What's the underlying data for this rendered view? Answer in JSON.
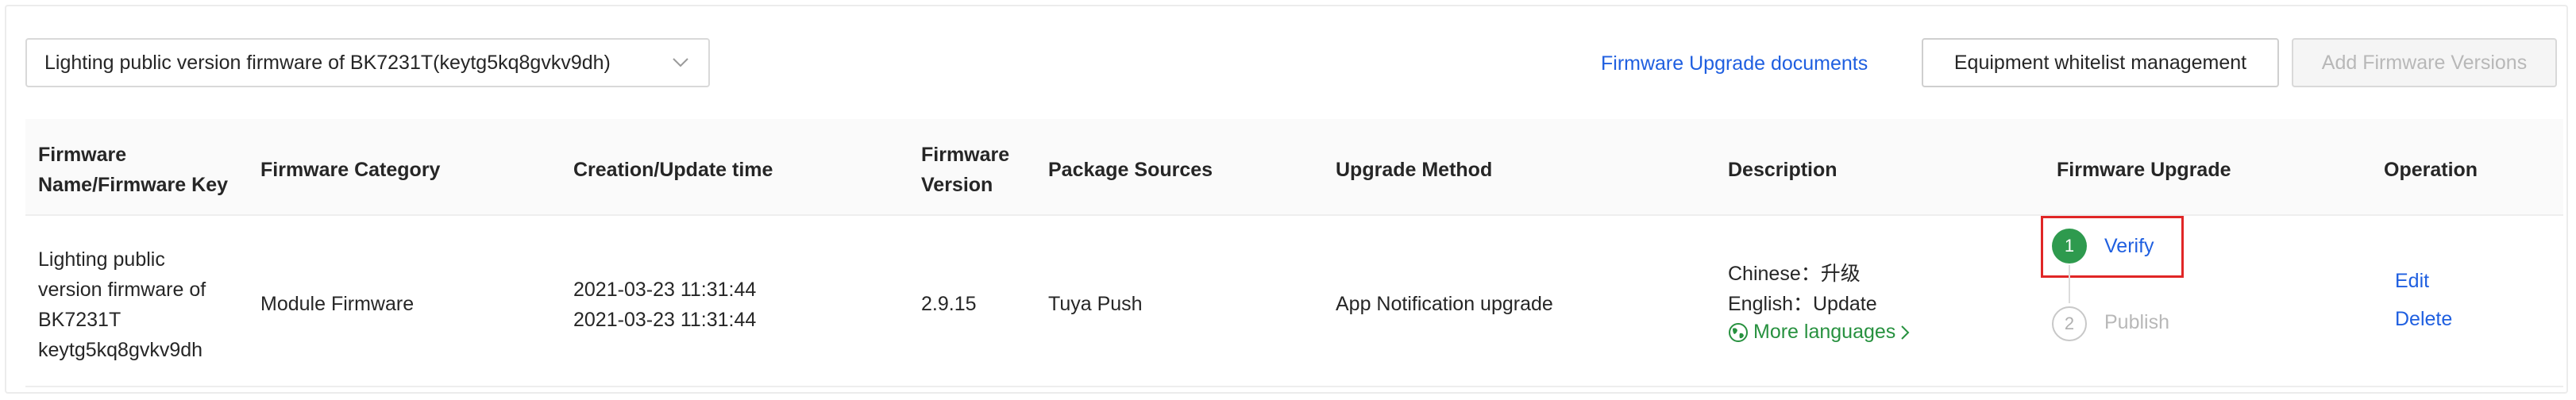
{
  "toolbar": {
    "firmware_selector_value": "Lighting public version firmware of BK7231T(keytg5kq8gvkv9dh)",
    "docs_link": "Firmware Upgrade documents",
    "whitelist_button": "Equipment whitelist management",
    "add_button": "Add Firmware Versions"
  },
  "table": {
    "headers": {
      "name_line1": "Firmware",
      "name_line2": "Name/Firmware Key",
      "category": "Firmware Category",
      "time": "Creation/Update time",
      "version_line1": "Firmware",
      "version_line2": "Version",
      "package": "Package Sources",
      "method": "Upgrade Method",
      "description": "Description",
      "upgrade": "Firmware Upgrade",
      "operation": "Operation"
    },
    "row": {
      "name_lines": [
        "Lighting public",
        "version firmware of",
        "BK7231T",
        "keytg5kq8gvkv9dh"
      ],
      "category": "Module Firmware",
      "created": "2021-03-23 11:31:44",
      "updated": "2021-03-23 11:31:44",
      "version": "2.9.15",
      "package": "Tuya Push",
      "method": "App Notification upgrade",
      "desc_chinese": "Chinese：升级",
      "desc_english": "English：Update",
      "more_languages": "More languages",
      "step1_number": "1",
      "step1_label": "Verify",
      "step2_number": "2",
      "step2_label": "Publish",
      "edit": "Edit",
      "delete": "Delete"
    }
  },
  "colors": {
    "link": "#1f5fe0",
    "success": "#2e9a4e",
    "highlight_border": "#e02626",
    "disabled_text": "#b8b8b8"
  }
}
